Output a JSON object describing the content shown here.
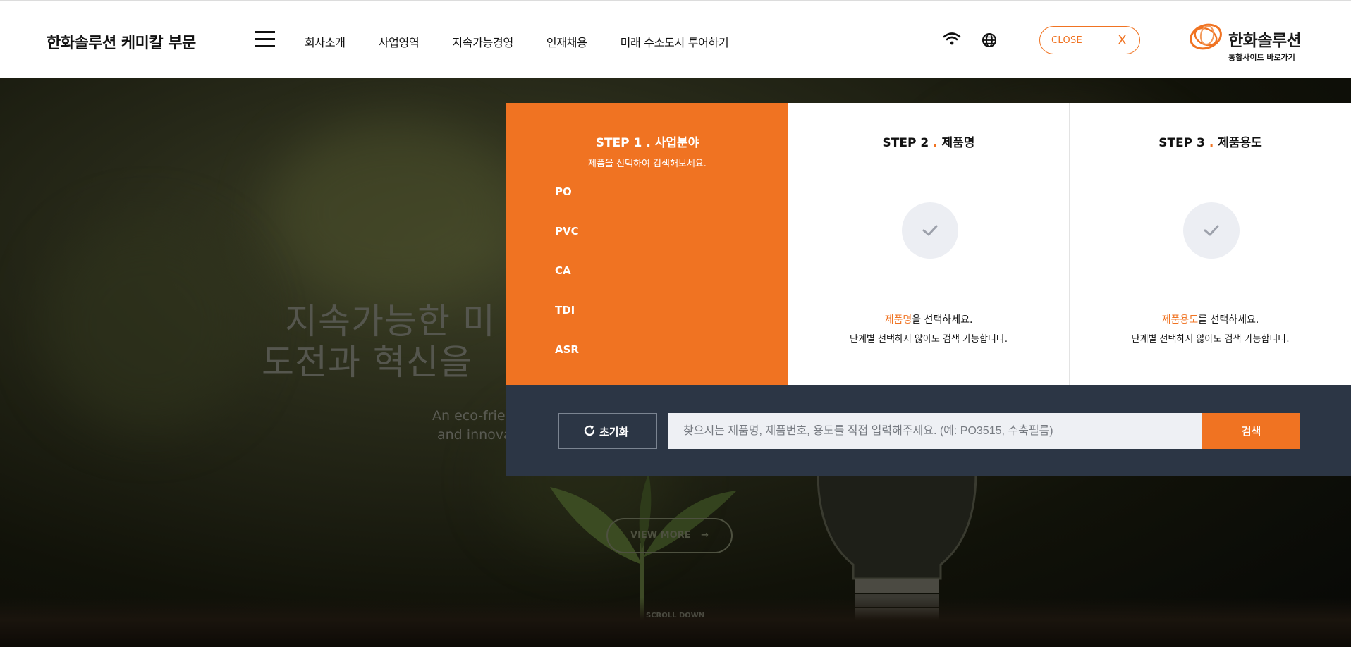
{
  "header": {
    "brand": "한화솔루션 케미칼 부문",
    "nav": [
      "회사소개",
      "사업영역",
      "지속가능경영",
      "인재채용",
      "미래 수소도시 투어하기"
    ],
    "close_label": "CLOSE",
    "close_x": "X",
    "logo_text": "한화솔루션",
    "logo_sub": "통합사이트 바로가기"
  },
  "hero": {
    "title_line1": "지속가능한 미",
    "title_line2": "도전과 혁신을",
    "sub_line1": "An eco-frien",
    "sub_line2": "and innova",
    "view_more": "VIEW MORE",
    "view_more_arrow": "→",
    "scroll_down": "SCROLL DOWN"
  },
  "search_panel": {
    "step1": {
      "num": "STEP 1",
      "dot": ".",
      "title": "사업분야",
      "desc": "제품을 선택하여 검색해보세요.",
      "categories": [
        "PO",
        "PVC",
        "CA",
        "TDI",
        "ASR"
      ]
    },
    "step2": {
      "num": "STEP 2",
      "dot": ".",
      "title": "제품명",
      "hint_highlight": "제품명",
      "hint_rest": "을 선택하세요.",
      "note": "단계별 선택하지 않아도 검색 가능합니다."
    },
    "step3": {
      "num": "STEP 3",
      "dot": ".",
      "title": "제품용도",
      "hint_highlight": "제품용도",
      "hint_rest": "를 선택하세요.",
      "note": "단계별 선택하지 않아도 검색 가능합니다."
    },
    "reset_label": "초기화",
    "search_placeholder": "찾으시는 제품명, 제품번호, 용도를 직접 입력해주세요. (예: PO3515, 수축필름)",
    "search_button": "검색"
  },
  "icons": {
    "menu": "hamburger-menu-icon",
    "wifi": "wifi-icon",
    "globe": "globe-icon",
    "check": "check-icon",
    "reset": "refresh-icon"
  },
  "colors": {
    "accent": "#f07322",
    "search_bar_bg": "#2c3645",
    "input_bg": "#eef0f4",
    "check_circle_bg": "#eceef3"
  }
}
